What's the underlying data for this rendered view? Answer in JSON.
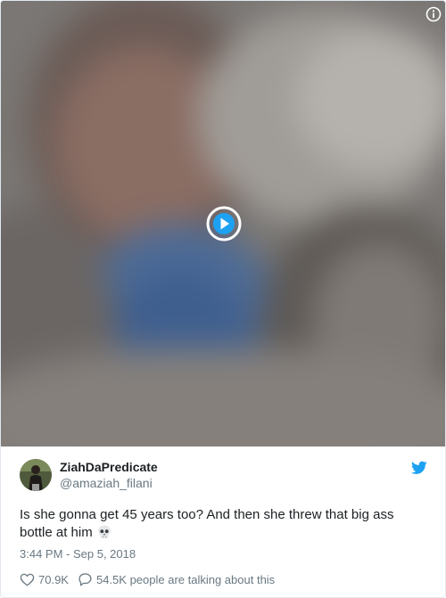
{
  "media": {
    "play_icon": "play-icon",
    "info_icon": "info-icon"
  },
  "tweet": {
    "display_name": "ZiahDaPredicate",
    "handle": "@amaziah_filani",
    "text": "Is she gonna get 45 years too? And then she threw that big ass bottle at him",
    "emoji": "skull-emoji",
    "timestamp": "3:44 PM - Sep 5, 2018",
    "likes": "70.9K",
    "replies_text": "54.5K people are talking about this"
  },
  "colors": {
    "accent": "#1da1f2",
    "text": "#1c2022",
    "muted": "#697882"
  }
}
